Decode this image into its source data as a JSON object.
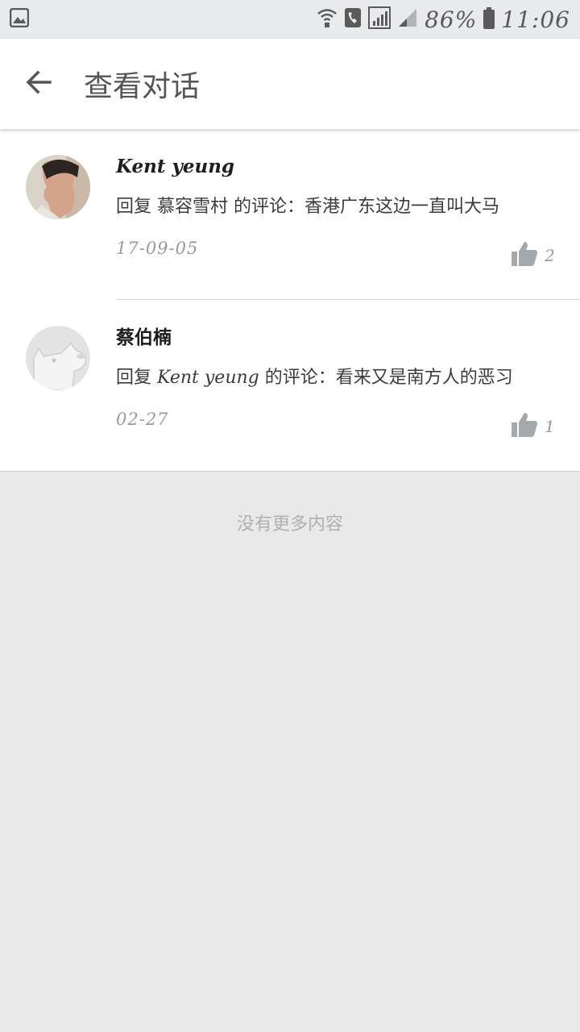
{
  "status_bar": {
    "battery": "86%",
    "time": "11:06",
    "icons": [
      "image-icon",
      "wifi-call-icon",
      "phone-icon",
      "signal-icon",
      "signal-weak-icon",
      "battery-icon"
    ]
  },
  "header": {
    "back_icon": "arrow-left-icon",
    "title": "查看对话"
  },
  "comments": [
    {
      "author": "Kent yeung",
      "reply_prefix": "回复",
      "reply_target": "慕容雪村",
      "reply_suffix": "的评论：香港广东这边一直叫大马",
      "date": "17-09-05",
      "likes": "2"
    },
    {
      "author": "蔡伯楠",
      "reply_prefix": "回复",
      "reply_target": "Kent yeung",
      "reply_suffix": "的评论：看来又是南方人的恶习",
      "date": "02-27",
      "likes": "1"
    }
  ],
  "footer": {
    "no_more": "没有更多内容"
  },
  "colors": {
    "status_bg": "#e8eaed",
    "app_bar_bg": "#ffffff",
    "page_bg": "#e9e9e9",
    "like_icon": "#a4a9ad"
  }
}
